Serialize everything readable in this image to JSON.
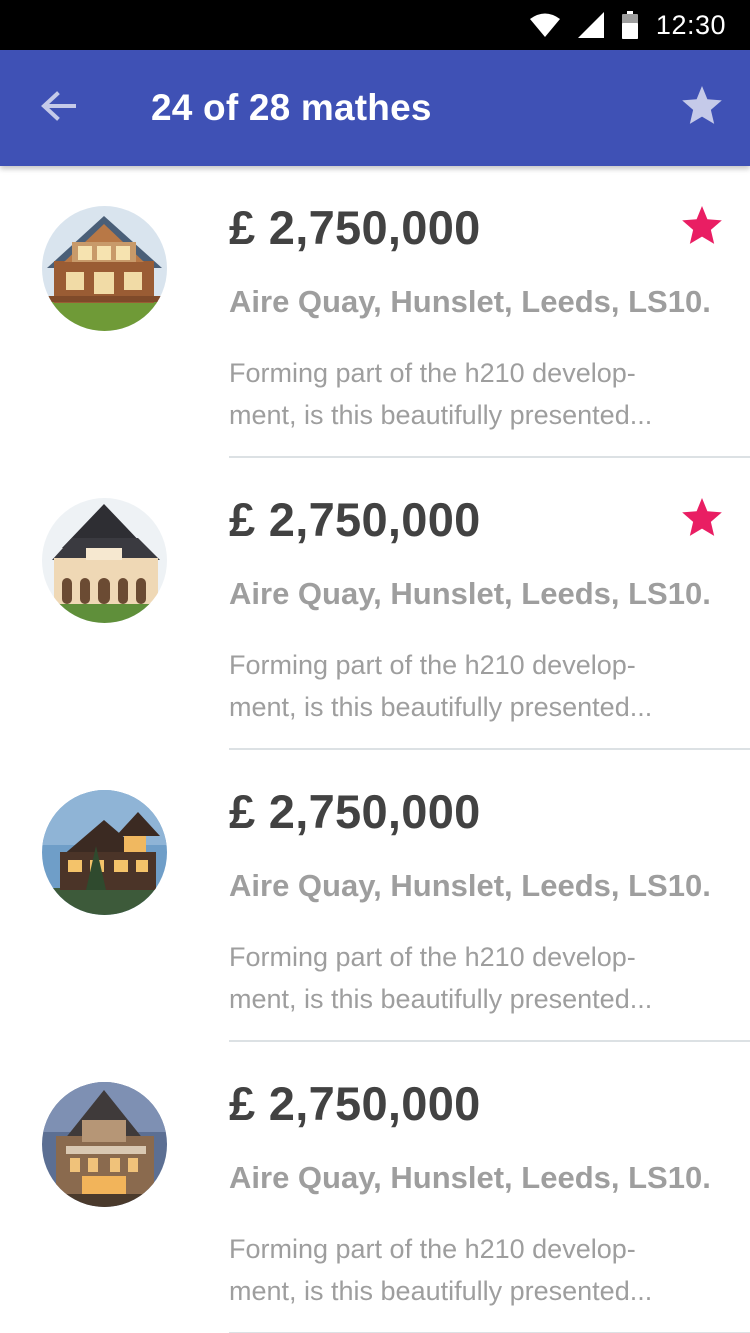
{
  "status_bar": {
    "time": "12:30",
    "icons": [
      "wifi-icon",
      "cell-signal-icon",
      "battery-icon"
    ]
  },
  "app_bar": {
    "title": "24 of 28 mathes",
    "back_icon": "arrow-left-icon",
    "action_icon": "star-icon",
    "background_color": "#3F51B5"
  },
  "colors": {
    "favorite_star": "#E91E63",
    "app_bar_star": "#C5CAE9",
    "price_text": "#424242",
    "secondary_text": "#9E9E9E"
  },
  "listings": [
    {
      "price": "£ 2,750,000",
      "address": "Aire Quay, Hunslet, Leeds, LS10.",
      "desc_line1": "Forming part of the h210 develop-",
      "desc_line2": "ment, is this beautifully presented...",
      "favorite": true,
      "image": "log-house-photo"
    },
    {
      "price": "£ 2,750,000",
      "address": "Aire Quay, Hunslet, Leeds, LS10.",
      "desc_line1": "Forming part of the h210 develop-",
      "desc_line2": "ment, is this beautifully presented...",
      "favorite": true,
      "image": "villa-photo"
    },
    {
      "price": "£ 2,750,000",
      "address": "Aire Quay, Hunslet, Leeds, LS10.",
      "desc_line1": "Forming part of the h210 develop-",
      "desc_line2": "ment, is this beautifully presented...",
      "favorite": false,
      "image": "lodge-photo"
    },
    {
      "price": "£ 2,750,000",
      "address": "Aire Quay, Hunslet, Leeds, LS10.",
      "desc_line1": "Forming part of the h210 develop-",
      "desc_line2": "ment, is this beautifully presented...",
      "favorite": false,
      "image": "mansion-photo"
    }
  ]
}
